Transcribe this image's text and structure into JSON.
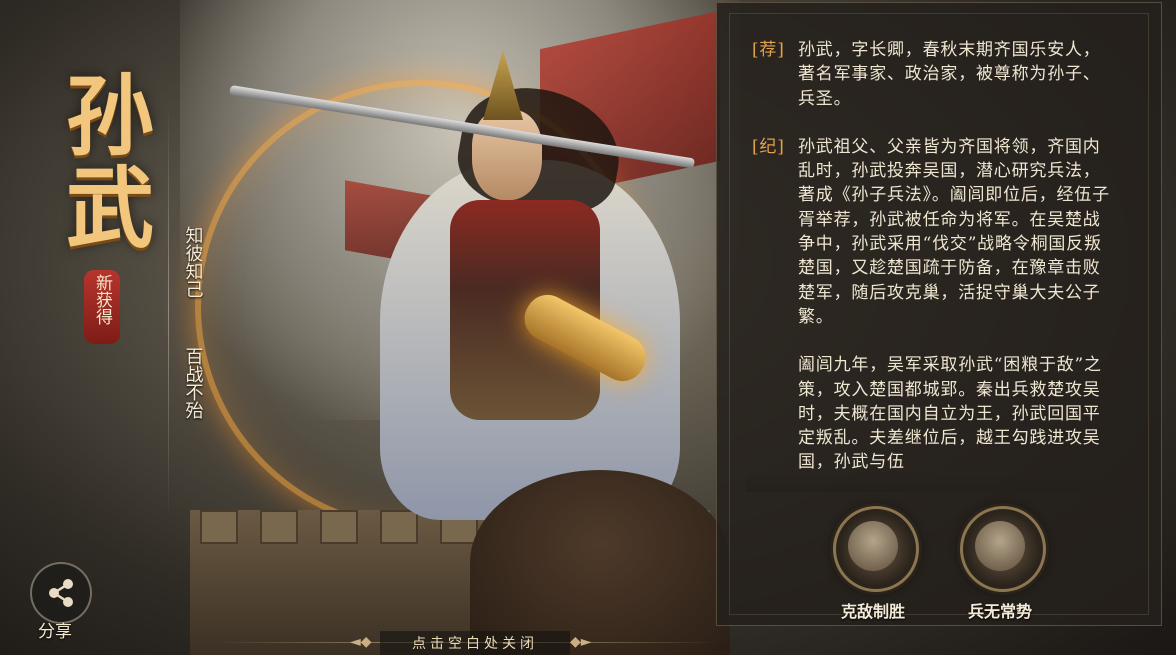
{
  "hero": {
    "name_chars": [
      "孙",
      "武"
    ],
    "badge": "新获得",
    "motto": [
      "知彼知己",
      "百战不殆"
    ]
  },
  "bio": {
    "paragraphs": [
      {
        "tag": "[荐]",
        "text": "孙武，字长卿，春秋末期齐国乐安人，著名军事家、政治家，被尊称为孙子、兵圣。"
      },
      {
        "tag": "[纪]",
        "text": "孙武祖父、父亲皆为齐国将领，齐国内乱时，孙武投奔吴国，潜心研究兵法，著成《孙子兵法》。阖闾即位后，经伍子胥举荐，孙武被任命为将军。在吴楚战争中，孙武采用“伐交”战略令桐国反叛楚国，又趁楚国疏于防备，在豫章击败楚军，随后攻克巢，活捉守巢大夫公子繁。"
      },
      {
        "tag": "",
        "text": "阖闾九年，吴军采取孙武“困粮于敌”之策，攻入楚国都城郢。秦出兵救楚攻吴时，夫概在国内自立为王，孙武回国平定叛乱。夫差继位后，越王勾践进攻吴国，孙武与伍"
      }
    ]
  },
  "skills": [
    {
      "name": "克敌制胜",
      "icon": "general-portrait-icon"
    },
    {
      "name": "兵无常势",
      "icon": "cavalry-portrait-icon"
    }
  ],
  "share": {
    "label": "分享",
    "icon": "share-icon"
  },
  "close_hint": "点击空白处关闭",
  "colors": {
    "title_gold": "#f2c77d",
    "tag_gold": "#e0a24a",
    "seal_red": "#b7352d",
    "panel_bg": "#24201b"
  }
}
